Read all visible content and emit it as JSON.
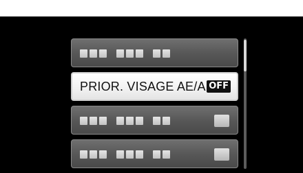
{
  "menu": {
    "items": [
      {
        "label": "",
        "value": "",
        "selected": false,
        "has_value_icon": false
      },
      {
        "label": "PRIOR. VISAGE AE/AF",
        "value": "OFF",
        "selected": true,
        "has_value_icon": true
      },
      {
        "label": "",
        "value": "",
        "selected": false,
        "has_value_icon": true
      },
      {
        "label": "",
        "value": "",
        "selected": false,
        "has_value_icon": true
      }
    ]
  },
  "scrollbar": {
    "position_fraction": 0.0
  },
  "colors": {
    "background": "#000000",
    "item_bg": "#5e5e5e",
    "selected_bg": "#f2f2f2",
    "badge_bg": "#111111"
  }
}
